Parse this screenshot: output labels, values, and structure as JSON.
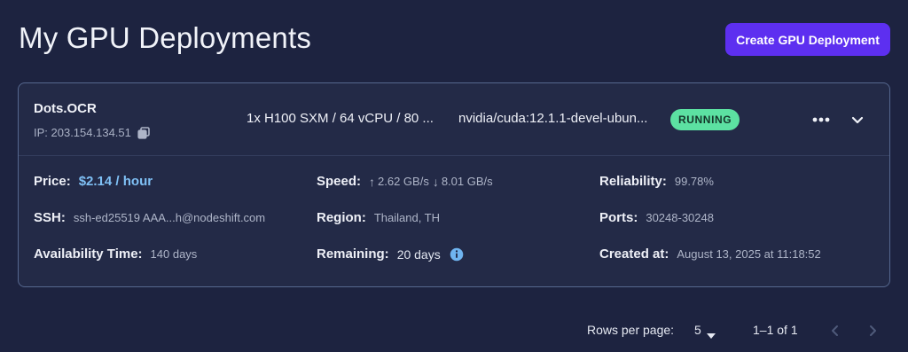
{
  "header": {
    "title": "My GPU Deployments",
    "create_button_label": "Create GPU Deployment"
  },
  "deployment": {
    "name": "Dots.OCR",
    "ip_label": "IP: 203.154.134.51",
    "gpu_spec": "1x H100 SXM / 64 vCPU / 80 ...",
    "image": "nvidia/cuda:12.1.1-devel-ubun...",
    "status": "RUNNING",
    "details": {
      "price_label": "Price:",
      "price_value": "$2.14 / hour",
      "ssh_label": "SSH:",
      "ssh_value": "ssh-ed25519 AAA...h@nodeshift.com",
      "availability_label": "Availability Time:",
      "availability_value": "140 days",
      "speed_label": "Speed:",
      "speed_up_arrow": "↑",
      "speed_up_value": "2.62 GB/s",
      "speed_down_arrow": "↓",
      "speed_down_value": "8.01 GB/s",
      "region_label": "Region:",
      "region_value": "Thailand, TH",
      "remaining_label": "Remaining:",
      "remaining_value": "20 days",
      "reliability_label": "Reliability:",
      "reliability_value": "99.78%",
      "ports_label": "Ports:",
      "ports_value": "30248-30248",
      "created_label": "Created at:",
      "created_value": "August 13, 2025 at 11:18:52"
    }
  },
  "pagination": {
    "rows_per_page_label": "Rows per page:",
    "rows_per_page_value": "5",
    "range_text": "1–1 of 1"
  },
  "icons": {
    "copy": "copy-icon",
    "more": "more-horizontal-icon",
    "expand": "chevron-down-icon",
    "info": "info-icon",
    "prev": "chevron-left-icon",
    "next": "chevron-right-icon"
  },
  "colors": {
    "background": "#1d2340",
    "card": "#232a47",
    "card_border": "#56688f",
    "primary_button": "#5d2ff0",
    "status_running": "#5ce1a2",
    "price": "#7fc0f5",
    "info_icon": "#6fb4f0"
  }
}
